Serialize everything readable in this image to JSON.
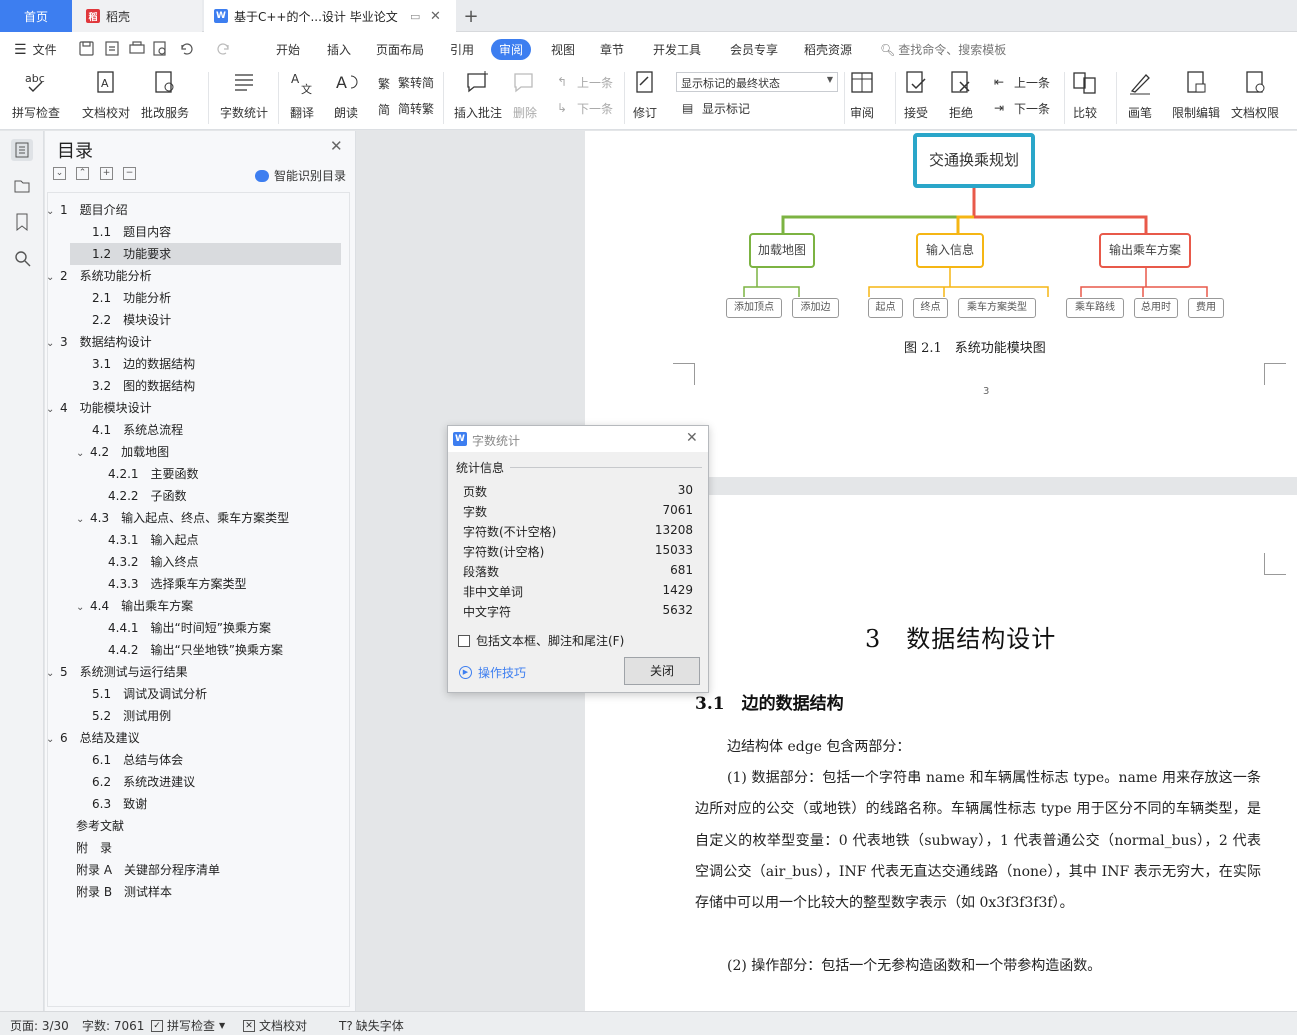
{
  "titlebar": {
    "tab_home": "首页",
    "tab_daoke": "稻壳",
    "tab_doc": "基于C++的个...设计 毕业论文",
    "tab_add": "+"
  },
  "menubar": {
    "file": "文件",
    "items": [
      "开始",
      "插入",
      "页面布局",
      "引用",
      "审阅",
      "视图",
      "章节",
      "开发工具",
      "会员专享",
      "稻壳资源"
    ],
    "active": "审阅",
    "search": "查找命令、搜索模板"
  },
  "ribbon": {
    "spellcheck": "拼写检查",
    "doc_proof": "文档校对",
    "annot_service": "批改服务",
    "word_count": "字数统计",
    "translate": "翻译",
    "read_aloud": "朗读",
    "trad_to_simp": "繁转简",
    "simp_to_trad": "简转繁",
    "insert_comment": "插入批注",
    "delete": "删除",
    "prev_comment": "上一条",
    "next_comment": "下一条",
    "revise": "修订",
    "markup_state": "显示标记的最终状态",
    "show_markup": "显示标记",
    "review": "审阅",
    "accept": "接受",
    "reject": "拒绝",
    "prev_change": "上一条",
    "next_change": "下一条",
    "compare": "比较",
    "pen": "画笔",
    "restrict_edit": "限制编辑",
    "doc_permission": "文档权限"
  },
  "toc": {
    "title": "目录",
    "smart": "智能识别目录",
    "items": [
      {
        "num": "1",
        "text": "题目介绍",
        "level": 1,
        "chev": true
      },
      {
        "num": "1.1",
        "text": "题目内容",
        "level": 2
      },
      {
        "num": "1.2",
        "text": "功能要求",
        "level": 2,
        "selected": true
      },
      {
        "num": "2",
        "text": "系统功能分析",
        "level": 1,
        "chev": true
      },
      {
        "num": "2.1",
        "text": "功能分析",
        "level": 2
      },
      {
        "num": "2.2",
        "text": "模块设计",
        "level": 2
      },
      {
        "num": "3",
        "text": "数据结构设计",
        "level": 1,
        "chev": true
      },
      {
        "num": "3.1",
        "text": "边的数据结构",
        "level": 2
      },
      {
        "num": "3.2",
        "text": "图的数据结构",
        "level": 2
      },
      {
        "num": "4",
        "text": "功能模块设计",
        "level": 1,
        "chev": true
      },
      {
        "num": "4.1",
        "text": "系统总流程",
        "level": 2
      },
      {
        "num": "4.2",
        "text": "加载地图",
        "level": 2,
        "chev": true
      },
      {
        "num": "4.2.1",
        "text": "主要函数",
        "level": 3
      },
      {
        "num": "4.2.2",
        "text": "子函数",
        "level": 3
      },
      {
        "num": "4.3",
        "text": "输入起点、终点、乘车方案类型",
        "level": 2,
        "chev": true
      },
      {
        "num": "4.3.1",
        "text": "输入起点",
        "level": 3
      },
      {
        "num": "4.3.2",
        "text": "输入终点",
        "level": 3
      },
      {
        "num": "4.3.3",
        "text": "选择乘车方案类型",
        "level": 3
      },
      {
        "num": "4.4",
        "text": "输出乘车方案",
        "level": 2,
        "chev": true
      },
      {
        "num": "4.4.1",
        "text": "输出“时间短”换乘方案",
        "level": 3
      },
      {
        "num": "4.4.2",
        "text": "输出“只坐地铁”换乘方案",
        "level": 3
      },
      {
        "num": "5",
        "text": "系统测试与运行结果",
        "level": 1,
        "chev": true
      },
      {
        "num": "5.1",
        "text": "调试及调试分析",
        "level": 2
      },
      {
        "num": "5.2",
        "text": "测试用例",
        "level": 2
      },
      {
        "num": "6",
        "text": "总结及建议",
        "level": 1,
        "chev": true
      },
      {
        "num": "6.1",
        "text": "总结与体会",
        "level": 2
      },
      {
        "num": "6.2",
        "text": "系统改进建议",
        "level": 2
      },
      {
        "num": "6.3",
        "text": "致谢",
        "level": 2
      },
      {
        "num": "",
        "text": "参考文献",
        "level": 0
      },
      {
        "num": "",
        "text": "附　录",
        "level": 0
      },
      {
        "num": "",
        "text": "附录 A　关键部分程序清单",
        "level": 0
      },
      {
        "num": "",
        "text": "附录 B　测试样本",
        "level": 0
      }
    ]
  },
  "mindmap": {
    "root": "交通换乘规划",
    "branches": [
      {
        "label": "加载地图",
        "color": "#7cb342",
        "leaves": [
          "添加顶点",
          "添加边"
        ]
      },
      {
        "label": "输入信息",
        "color": "#f5b614",
        "leaves": [
          "起点",
          "终点",
          "乘车方案类型"
        ]
      },
      {
        "label": "输出乘车方案",
        "color": "#e8594a",
        "leaves": [
          "乘车路线",
          "总用时",
          "费用"
        ]
      }
    ],
    "caption": "图 2.1　系统功能模块图",
    "page_number": "3"
  },
  "page2": {
    "chapter": "3　数据结构设计",
    "section": "3.1　边的数据结构",
    "paragraphs": [
      "边结构体 edge 包含两部分：",
      "(1) 数据部分：包括一个字符串 name 和车辆属性标志 type。name 用来存放这一条边所对应的公交（或地铁）的线路名称。车辆属性标志 type 用于区分不同的车辆类型，是自定义的枚举型变量：0 代表地铁（subway），1 代表普通公交（normal_bus），2 代表空调公交（air_bus），INF 代表无直达交通线路（none），其中 INF 表示无穷大，在实际存储中可以用一个比较大的整型数字表示（如 0x3f3f3f3f）。",
      "(2) 操作部分：包括一个无参构造函数和一个带参构造函数。"
    ]
  },
  "dialog": {
    "title": "字数统计",
    "section": "统计信息",
    "stats": [
      {
        "label": "页数",
        "value": "30"
      },
      {
        "label": "字数",
        "value": "7061"
      },
      {
        "label": "字符数(不计空格)",
        "value": "13208"
      },
      {
        "label": "字符数(计空格)",
        "value": "15033"
      },
      {
        "label": "段落数",
        "value": "681"
      },
      {
        "label": "非中文单词",
        "value": "1429"
      },
      {
        "label": "中文字符",
        "value": "5632"
      }
    ],
    "checkbox": "包括文本框、脚注和尾注(F)",
    "tips": "操作技巧",
    "close": "关闭"
  },
  "statusbar": {
    "page": "页面: 3/30",
    "words": "字数: 7061",
    "spellcheck": "拼写检查",
    "proof": "文档校对",
    "missing_font": "缺失字体"
  },
  "colors": {
    "accent": "#3d7ef0",
    "mindmap_root": "#2aa6c9"
  }
}
